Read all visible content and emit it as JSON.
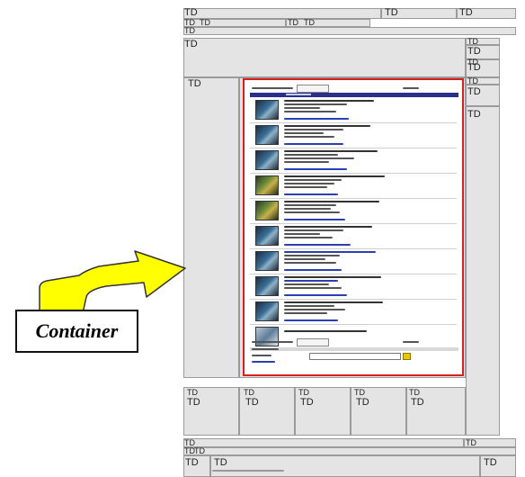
{
  "cell_label": "TD",
  "callout": {
    "label": "Container",
    "arrow_color": "#ffff00",
    "arrow_stroke": "#333333"
  },
  "container": {
    "border_color": "#d42020",
    "header_bar_color": "#2b2f8a",
    "item_count": 10
  }
}
